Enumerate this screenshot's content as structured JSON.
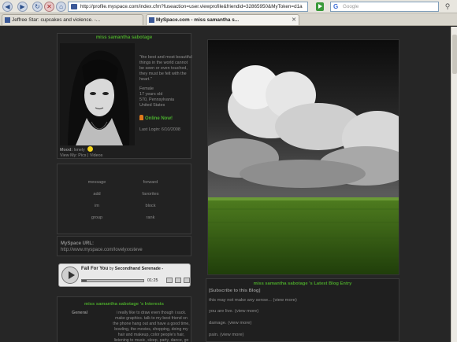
{
  "browser": {
    "address": "http://profile.myspace.com/index.cfm?fuseaction=user.viewprofile&friendid=32865950&MyToken=d1a",
    "search_placeholder": "Google",
    "tabs": [
      {
        "label": "Jeffree Star: cupcakes and violence. -..."
      },
      {
        "label": "MySpace.com - miss samantha s..."
      }
    ]
  },
  "profile": {
    "name": "miss samantha sabotage",
    "quote": "\"the best and most beautiful things in the world cannot be seen or even touched, they must be felt with the heart.\"",
    "gender": "Female",
    "age": "17 years old",
    "location": "570, Pennsylvania",
    "country": "United States",
    "online": "Online Now!",
    "last_login": "Last Login: 6/10/2008",
    "mood_label": "Mood:",
    "mood_value": "lonely",
    "view_my": "View My:",
    "pics": "Pics",
    "videos": "Videos"
  },
  "contact": {
    "items": [
      "message",
      "forward",
      "add",
      "favorites",
      "im",
      "block",
      "group",
      "rank"
    ]
  },
  "url_box": {
    "label": "MySpace URL:",
    "value": "http://www.myspace.com/lovelyxxsteve"
  },
  "player": {
    "song": "Fall For You",
    "by": "by",
    "band": "Secondhand Serenade -",
    "time": "01:25",
    "progress": 0.08
  },
  "interests": {
    "title": "miss samantha sabotage 's Interests",
    "label": "General",
    "text": "i really like to draw even though i suck. make graphics. talk to my best friend on the phone hang out and have a good time, bowling, the movies, shopping, doing my hair and makeup, color people's hair, listening to music, sleep, party, dance, go on road trips to places, travel,"
  },
  "blog": {
    "title": "miss samantha sabotage 's Latest Blog Entry",
    "subscribe": "[Subscribe to this Blog]",
    "view_more": "(view more)",
    "entries": [
      "this may not make any sense...",
      "you are live.",
      "damage.",
      "pain."
    ]
  }
}
